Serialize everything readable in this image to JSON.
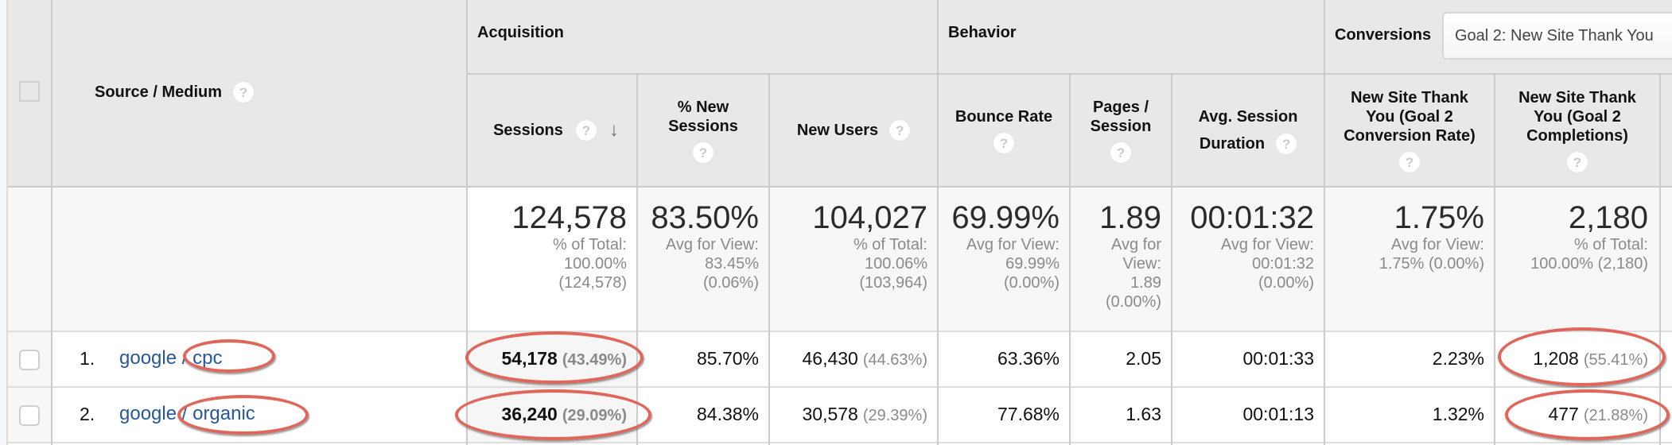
{
  "header": {
    "dimension_label": "Source / Medium",
    "groups": {
      "acquisition": "Acquisition",
      "behavior": "Behavior",
      "conversions": "Conversions"
    },
    "goal_select": {
      "value": "Goal 2: New Site Thank You"
    },
    "columns": {
      "sessions": "Sessions",
      "pct_new_sessions_l1": "% New",
      "pct_new_sessions_l2": "Sessions",
      "new_users": "New Users",
      "bounce_rate": "Bounce Rate",
      "pages_session_l1": "Pages /",
      "pages_session_l2": "Session",
      "avg_session_l1": "Avg. Session",
      "avg_session_l2": "Duration",
      "conv_rate_l1": "New Site Thank",
      "conv_rate_l2": "You (Goal 2",
      "conv_rate_l3": "Conversion Rate)",
      "completions_l1": "New Site Thank",
      "completions_l2": "You (Goal 2",
      "completions_l3": "Completions)"
    },
    "help_glyph": "?",
    "sort_glyph": "↓",
    "sorted_column": "sessions",
    "sort_direction": "descending"
  },
  "totals": {
    "sessions": {
      "value": "124,578",
      "sub1": "% of Total:",
      "sub2": "100.00%",
      "sub3": "(124,578)"
    },
    "pct_new_sessions": {
      "value": "83.50%",
      "sub1": "Avg for View:",
      "sub2": "83.45%",
      "sub3": "(0.06%)"
    },
    "new_users": {
      "value": "104,027",
      "sub1": "% of Total:",
      "sub2": "100.06%",
      "sub3": "(103,964)"
    },
    "bounce_rate": {
      "value": "69.99%",
      "sub1": "Avg for View:",
      "sub2": "69.99%",
      "sub3": "(0.00%)"
    },
    "pages_session": {
      "value": "1.89",
      "sub1": "Avg for",
      "sub2": "View:",
      "sub3": "1.89",
      "sub4": "(0.00%)"
    },
    "avg_session_duration": {
      "value": "00:01:32",
      "sub1": "Avg for View:",
      "sub2": "00:01:32",
      "sub3": "(0.00%)"
    },
    "conv_rate": {
      "value": "1.75%",
      "sub1": "Avg for View:",
      "sub2": "1.75% (0.00%)"
    },
    "completions": {
      "value": "2,180",
      "sub1": "% of Total:",
      "sub2": "100.00% (2,180)"
    }
  },
  "rows": [
    {
      "index": "1.",
      "source": "google",
      "separator": " / ",
      "medium": "cpc",
      "sessions": "54,178",
      "sessions_pct": "(43.49%)",
      "pct_new_sessions": "85.70%",
      "new_users": "46,430",
      "new_users_pct": "(44.63%)",
      "bounce_rate": "63.36%",
      "pages_session": "2.05",
      "avg_session_duration": "00:01:33",
      "conv_rate": "2.23%",
      "completions": "1,208",
      "completions_pct": "(55.41%)",
      "checked": false
    },
    {
      "index": "2.",
      "source": "google",
      "separator": " / ",
      "medium": "organic",
      "sessions": "36,240",
      "sessions_pct": "(29.09%)",
      "pct_new_sessions": "84.38%",
      "new_users": "30,578",
      "new_users_pct": "(29.39%)",
      "bounce_rate": "77.68%",
      "pages_session": "1.63",
      "avg_session_duration": "00:01:13",
      "conv_rate": "1.32%",
      "completions": "477",
      "completions_pct": "(21.88%)",
      "checked": false
    }
  ],
  "annotations": {
    "color": "#e0665a",
    "highlighted": [
      "row1-medium",
      "row2-medium",
      "row1-sessions",
      "row2-sessions",
      "row1-completions",
      "row2-completions"
    ]
  }
}
